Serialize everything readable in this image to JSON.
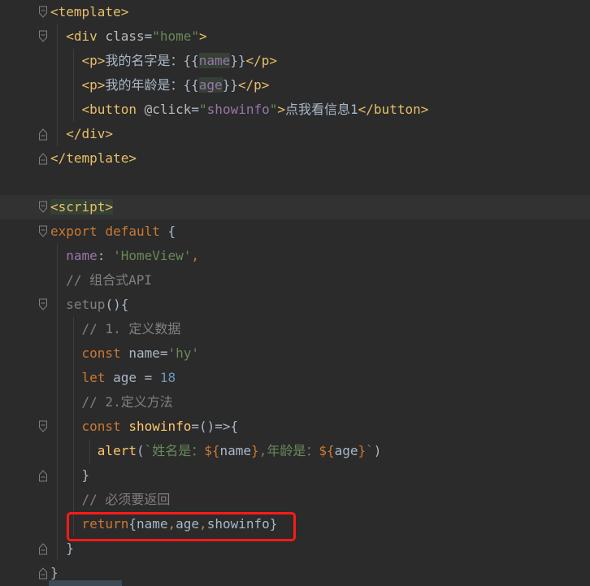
{
  "editor": {
    "lines": [
      {
        "segments": [
          {
            "t": "<template>",
            "c": "tok-tag"
          }
        ]
      },
      {
        "segments": [
          {
            "t": "  "
          },
          {
            "t": "<div ",
            "c": "tok-tag"
          },
          {
            "t": "class",
            "c": "tok-attr"
          },
          {
            "t": "=",
            "c": "tok-def"
          },
          {
            "t": "\"home\"",
            "c": "tok-str"
          },
          {
            "t": ">",
            "c": "tok-tag"
          }
        ]
      },
      {
        "segments": [
          {
            "t": "    "
          },
          {
            "t": "<p>",
            "c": "tok-tag"
          },
          {
            "t": "我的名字是：{{",
            "c": "tok-def"
          },
          {
            "t": "name",
            "c": "tok-field tok-hl-bg"
          },
          {
            "t": "}}",
            "c": "tok-def"
          },
          {
            "t": "</p>",
            "c": "tok-tag"
          }
        ]
      },
      {
        "segments": [
          {
            "t": "    "
          },
          {
            "t": "<p>",
            "c": "tok-tag"
          },
          {
            "t": "我的年龄是：{{",
            "c": "tok-def"
          },
          {
            "t": "age",
            "c": "tok-field tok-hl-bg"
          },
          {
            "t": "}}",
            "c": "tok-def"
          },
          {
            "t": "</p>",
            "c": "tok-tag"
          }
        ]
      },
      {
        "segments": [
          {
            "t": "    "
          },
          {
            "t": "<button ",
            "c": "tok-tag"
          },
          {
            "t": "@click",
            "c": "tok-attr"
          },
          {
            "t": "=",
            "c": "tok-def"
          },
          {
            "t": "\"",
            "c": "tok-str"
          },
          {
            "t": "showinfo",
            "c": "tok-field"
          },
          {
            "t": "\"",
            "c": "tok-str"
          },
          {
            "t": ">",
            "c": "tok-tag"
          },
          {
            "t": "点我看信息1",
            "c": "tok-def"
          },
          {
            "t": "</button>",
            "c": "tok-tag"
          }
        ]
      },
      {
        "segments": [
          {
            "t": "  "
          },
          {
            "t": "</div>",
            "c": "tok-tag"
          }
        ]
      },
      {
        "segments": [
          {
            "t": "</template>",
            "c": "tok-tag"
          }
        ]
      },
      {
        "segments": []
      },
      {
        "segments": [
          {
            "t": "<script>",
            "c": "tok-tag tok-hl-bg"
          }
        ]
      },
      {
        "segments": [
          {
            "t": "export ",
            "c": "tok-kw"
          },
          {
            "t": "default ",
            "c": "tok-kw"
          },
          {
            "t": "{",
            "c": "tok-def"
          }
        ]
      },
      {
        "segments": [
          {
            "t": "  "
          },
          {
            "t": "name",
            "c": "tok-field"
          },
          {
            "t": ": ",
            "c": "tok-def"
          },
          {
            "t": "'HomeView'",
            "c": "tok-str"
          },
          {
            "t": ",",
            "c": "tok-kw"
          }
        ]
      },
      {
        "segments": [
          {
            "t": "  "
          },
          {
            "t": "// 组合式API",
            "c": "tok-cmt"
          }
        ]
      },
      {
        "segments": [
          {
            "t": "  "
          },
          {
            "t": "setup",
            "c": "tok-cmt"
          },
          {
            "t": "(){",
            "c": "tok-def"
          }
        ]
      },
      {
        "segments": [
          {
            "t": "    "
          },
          {
            "t": "// 1. 定义数据",
            "c": "tok-cmt"
          }
        ]
      },
      {
        "segments": [
          {
            "t": "    "
          },
          {
            "t": "const ",
            "c": "tok-kw"
          },
          {
            "t": "name",
            "c": "tok-def"
          },
          {
            "t": "=",
            "c": "tok-def"
          },
          {
            "t": "'hy'",
            "c": "tok-str"
          }
        ]
      },
      {
        "segments": [
          {
            "t": "    "
          },
          {
            "t": "let ",
            "c": "tok-kw"
          },
          {
            "t": "age ",
            "c": "tok-def"
          },
          {
            "t": "= ",
            "c": "tok-def"
          },
          {
            "t": "18",
            "c": "tok-num"
          }
        ]
      },
      {
        "segments": [
          {
            "t": "    "
          },
          {
            "t": "// 2.定义方法",
            "c": "tok-cmt"
          }
        ]
      },
      {
        "segments": [
          {
            "t": "    "
          },
          {
            "t": "const ",
            "c": "tok-kw"
          },
          {
            "t": "showinfo",
            "c": "tok-fn"
          },
          {
            "t": "=()=>{",
            "c": "tok-def"
          }
        ]
      },
      {
        "segments": [
          {
            "t": "      "
          },
          {
            "t": "alert",
            "c": "tok-fn"
          },
          {
            "t": "(",
            "c": "tok-def"
          },
          {
            "t": "`姓名是：",
            "c": "tok-str"
          },
          {
            "t": "${",
            "c": "tok-kw"
          },
          {
            "t": "name",
            "c": "tok-def"
          },
          {
            "t": "}",
            "c": "tok-kw"
          },
          {
            "t": ",年龄是：",
            "c": "tok-str"
          },
          {
            "t": "${",
            "c": "tok-kw"
          },
          {
            "t": "age",
            "c": "tok-def"
          },
          {
            "t": "}",
            "c": "tok-kw"
          },
          {
            "t": "`",
            "c": "tok-str"
          },
          {
            "t": ")",
            "c": "tok-def"
          }
        ]
      },
      {
        "segments": [
          {
            "t": "    "
          },
          {
            "t": "}",
            "c": "tok-def"
          }
        ]
      },
      {
        "segments": [
          {
            "t": "    "
          },
          {
            "t": "// 必须要返回",
            "c": "tok-cmt"
          }
        ]
      },
      {
        "segments": [
          {
            "t": "    "
          },
          {
            "t": "return",
            "c": "tok-kw"
          },
          {
            "t": "{",
            "c": "tok-def"
          },
          {
            "t": "name",
            "c": "tok-def"
          },
          {
            "t": ",",
            "c": "tok-kw"
          },
          {
            "t": "age",
            "c": "tok-def"
          },
          {
            "t": ",",
            "c": "tok-kw"
          },
          {
            "t": "showinfo",
            "c": "tok-def"
          },
          {
            "t": "}",
            "c": "tok-def"
          }
        ]
      },
      {
        "segments": [
          {
            "t": "  "
          },
          {
            "t": "}",
            "c": "tok-def"
          }
        ]
      },
      {
        "segments": [
          {
            "t": "}",
            "c": "tok-def"
          }
        ]
      }
    ],
    "highlighted_line_index": 8,
    "fold_markers": [
      {
        "line": 0,
        "type": "open"
      },
      {
        "line": 1,
        "type": "open"
      },
      {
        "line": 5,
        "type": "close"
      },
      {
        "line": 6,
        "type": "close"
      },
      {
        "line": 8,
        "type": "open"
      },
      {
        "line": 9,
        "type": "open"
      },
      {
        "line": 12,
        "type": "open"
      },
      {
        "line": 17,
        "type": "open"
      },
      {
        "line": 19,
        "type": "close"
      },
      {
        "line": 22,
        "type": "close"
      },
      {
        "line": 23,
        "type": "close"
      }
    ],
    "annotation_color": "#ff1a1a"
  }
}
